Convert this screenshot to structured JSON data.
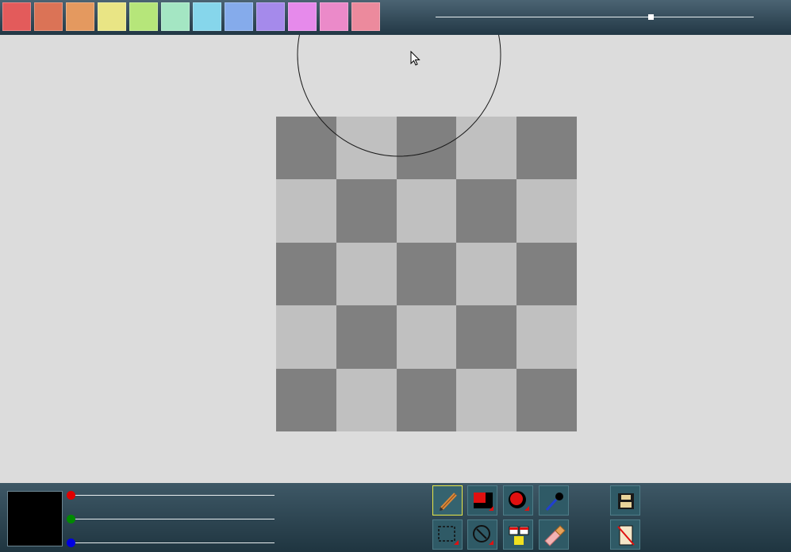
{
  "palette": {
    "colors": [
      "#e35b5b",
      "#db7356",
      "#e4995f",
      "#e9e585",
      "#b6e67a",
      "#a4e6c3",
      "#86d6eb",
      "#85abeb",
      "#a58aeb",
      "#e68aeb",
      "#eb8ac9",
      "#ec8a9d"
    ]
  },
  "brush_size_slider": {
    "value": 0.675
  },
  "canvas": {
    "pattern": [
      [
        "dark",
        "light",
        "dark",
        "light",
        "dark"
      ],
      [
        "light",
        "dark",
        "light",
        "dark",
        "light"
      ],
      [
        "dark",
        "light",
        "dark",
        "light",
        "dark"
      ],
      [
        "light",
        "dark",
        "light",
        "dark",
        "light"
      ],
      [
        "dark",
        "light",
        "dark",
        "light",
        "dark"
      ]
    ]
  },
  "current_color": {
    "hex": "#000000",
    "red": 0,
    "green": 0,
    "blue": 0
  },
  "tools": {
    "active": "pencil",
    "items": [
      {
        "name": "pencil",
        "icon": "pencil-icon"
      },
      {
        "name": "rectangle",
        "icon": "rectangle-icon"
      },
      {
        "name": "circle",
        "icon": "circle-icon"
      },
      {
        "name": "eyedropper",
        "icon": "eyedropper-icon"
      },
      {
        "name": "select",
        "icon": "select-icon"
      },
      {
        "name": "ellipse",
        "icon": "ellipse-icon"
      },
      {
        "name": "fill",
        "icon": "fill-icon"
      },
      {
        "name": "eraser",
        "icon": "eraser-icon"
      },
      {
        "name": "save",
        "icon": "save-icon"
      },
      {
        "name": "clear",
        "icon": "clear-icon"
      }
    ]
  }
}
